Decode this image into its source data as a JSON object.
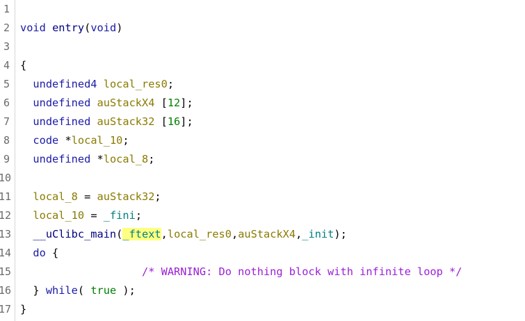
{
  "editor": {
    "lines": [
      {
        "n": "1",
        "parts": []
      },
      {
        "n": "2",
        "parts": [
          {
            "t": "void",
            "c": "kw"
          },
          {
            "t": " ",
            "c": "plain"
          },
          {
            "t": "entry",
            "c": "fn"
          },
          {
            "t": "(",
            "c": "plain"
          },
          {
            "t": "void",
            "c": "kw"
          },
          {
            "t": ")",
            "c": "plain"
          }
        ]
      },
      {
        "n": "3",
        "parts": []
      },
      {
        "n": "4",
        "parts": [
          {
            "t": "{",
            "c": "plain"
          }
        ]
      },
      {
        "n": "5",
        "parts": [
          {
            "t": "  ",
            "c": "plain"
          },
          {
            "t": "undefined4",
            "c": "kw"
          },
          {
            "t": " ",
            "c": "plain"
          },
          {
            "t": "local_res0",
            "c": "var"
          },
          {
            "t": ";",
            "c": "plain"
          }
        ]
      },
      {
        "n": "6",
        "parts": [
          {
            "t": "  ",
            "c": "plain"
          },
          {
            "t": "undefined",
            "c": "kw"
          },
          {
            "t": " ",
            "c": "plain"
          },
          {
            "t": "auStackX4",
            "c": "var"
          },
          {
            "t": " [",
            "c": "plain"
          },
          {
            "t": "12",
            "c": "num"
          },
          {
            "t": "];",
            "c": "plain"
          }
        ]
      },
      {
        "n": "7",
        "parts": [
          {
            "t": "  ",
            "c": "plain"
          },
          {
            "t": "undefined",
            "c": "kw"
          },
          {
            "t": " ",
            "c": "plain"
          },
          {
            "t": "auStack32",
            "c": "var"
          },
          {
            "t": " [",
            "c": "plain"
          },
          {
            "t": "16",
            "c": "num"
          },
          {
            "t": "];",
            "c": "plain"
          }
        ]
      },
      {
        "n": "8",
        "parts": [
          {
            "t": "  ",
            "c": "plain"
          },
          {
            "t": "code",
            "c": "kw"
          },
          {
            "t": " *",
            "c": "plain"
          },
          {
            "t": "local_10",
            "c": "var"
          },
          {
            "t": ";",
            "c": "plain"
          }
        ]
      },
      {
        "n": "9",
        "parts": [
          {
            "t": "  ",
            "c": "plain"
          },
          {
            "t": "undefined",
            "c": "kw"
          },
          {
            "t": " *",
            "c": "plain"
          },
          {
            "t": "local_8",
            "c": "var"
          },
          {
            "t": ";",
            "c": "plain"
          }
        ]
      },
      {
        "n": "10",
        "parts": []
      },
      {
        "n": "11",
        "parts": [
          {
            "t": "  ",
            "c": "plain"
          },
          {
            "t": "local_8",
            "c": "var"
          },
          {
            "t": " = ",
            "c": "plain"
          },
          {
            "t": "auStack32",
            "c": "var"
          },
          {
            "t": ";",
            "c": "plain"
          }
        ]
      },
      {
        "n": "12",
        "parts": [
          {
            "t": "  ",
            "c": "plain"
          },
          {
            "t": "local_10",
            "c": "var"
          },
          {
            "t": " = ",
            "c": "plain"
          },
          {
            "t": "_fini",
            "c": "glob"
          },
          {
            "t": ";",
            "c": "plain"
          }
        ]
      },
      {
        "n": "13",
        "parts": [
          {
            "t": "  ",
            "c": "plain"
          },
          {
            "t": "__uClibc_main",
            "c": "fn"
          },
          {
            "t": "(",
            "c": "plain"
          },
          {
            "t": "_ftext",
            "c": "glob hl"
          },
          {
            "t": ",",
            "c": "plain"
          },
          {
            "t": "local_res0",
            "c": "var"
          },
          {
            "t": ",",
            "c": "plain"
          },
          {
            "t": "auStackX4",
            "c": "var"
          },
          {
            "t": ",",
            "c": "plain"
          },
          {
            "t": "_init",
            "c": "glob"
          },
          {
            "t": ");",
            "c": "plain"
          }
        ]
      },
      {
        "n": "14",
        "parts": [
          {
            "t": "  ",
            "c": "plain"
          },
          {
            "t": "do",
            "c": "kw"
          },
          {
            "t": " {",
            "c": "plain"
          }
        ]
      },
      {
        "n": "15",
        "parts": [
          {
            "t": "                   ",
            "c": "plain"
          },
          {
            "t": "/* WARNING: Do nothing block with infinite loop */",
            "c": "cmt"
          }
        ]
      },
      {
        "n": "16",
        "parts": [
          {
            "t": "  } ",
            "c": "plain"
          },
          {
            "t": "while",
            "c": "kw"
          },
          {
            "t": "( ",
            "c": "plain"
          },
          {
            "t": "true",
            "c": "num"
          },
          {
            "t": " );",
            "c": "plain"
          }
        ]
      },
      {
        "n": "17",
        "parts": [
          {
            "t": "}",
            "c": "plain"
          }
        ]
      }
    ]
  }
}
